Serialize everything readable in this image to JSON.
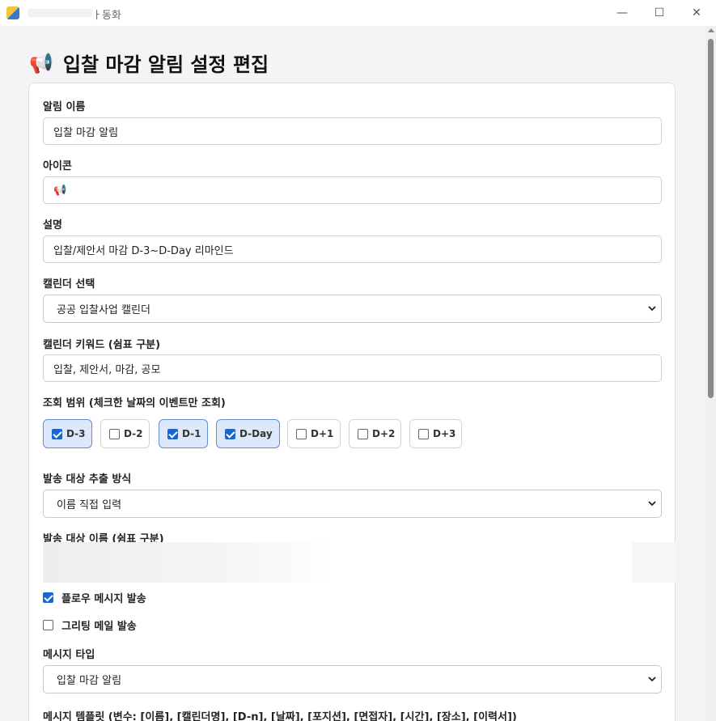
{
  "window": {
    "title": "ㅏ동화",
    "minimize_glyph": "—",
    "maximize_glyph": "☐",
    "close_glyph": "✕"
  },
  "header": {
    "icon": "📢",
    "title": "입찰 마감 알림 설정 편집"
  },
  "form": {
    "name_label": "알림 이름",
    "name_value": "입찰 마감 알림",
    "icon_label": "아이콘",
    "icon_value": "📢",
    "description_label": "설명",
    "description_value": "입찰/제안서 마감 D-3~D-Day 리마인드",
    "calendar_label": "캘린더 선택",
    "calendar_value": "공공 입찰사업 캘린더",
    "keywords_label": "캘린더 키워드 (쉼표 구분)",
    "keywords_value": "입찰, 제안서, 마감, 공모",
    "range_label": "조회 범위 (체크한 날짜의 이벤트만 조회)",
    "range_options": [
      {
        "label": "D-3",
        "checked": true
      },
      {
        "label": "D-2",
        "checked": false
      },
      {
        "label": "D-1",
        "checked": true
      },
      {
        "label": "D-Day",
        "checked": true
      },
      {
        "label": "D+1",
        "checked": false
      },
      {
        "label": "D+2",
        "checked": false
      },
      {
        "label": "D+3",
        "checked": false
      }
    ],
    "target_method_label": "발송 대상 추출 방식",
    "target_method_value": "이름 직접 입력",
    "target_names_label": "발송 대상 이름 (쉼표 구분)",
    "flow_message_label": "플로우 메시지 발송",
    "flow_message_checked": true,
    "greeting_mail_label": "그리팅 메일 발송",
    "greeting_mail_checked": false,
    "message_type_label": "메시지 타입",
    "message_type_value": "입찰 마감 알림",
    "template_label": "메시지 템플릿 (변수: [이름], [캘린더명], [D-n], [날짜], [포지션], [면접자], [시간], [장소], [이력서])"
  },
  "colors": {
    "accent": "#1a66cf",
    "chip_selected_bg": "#dde9fb",
    "chip_selected_border": "#5b8fd9",
    "page_bg": "#f4f4f7"
  },
  "icons": {
    "app": "app-icon",
    "megaphone": "megaphone-icon",
    "dropdown": "chevron-down-icon"
  }
}
